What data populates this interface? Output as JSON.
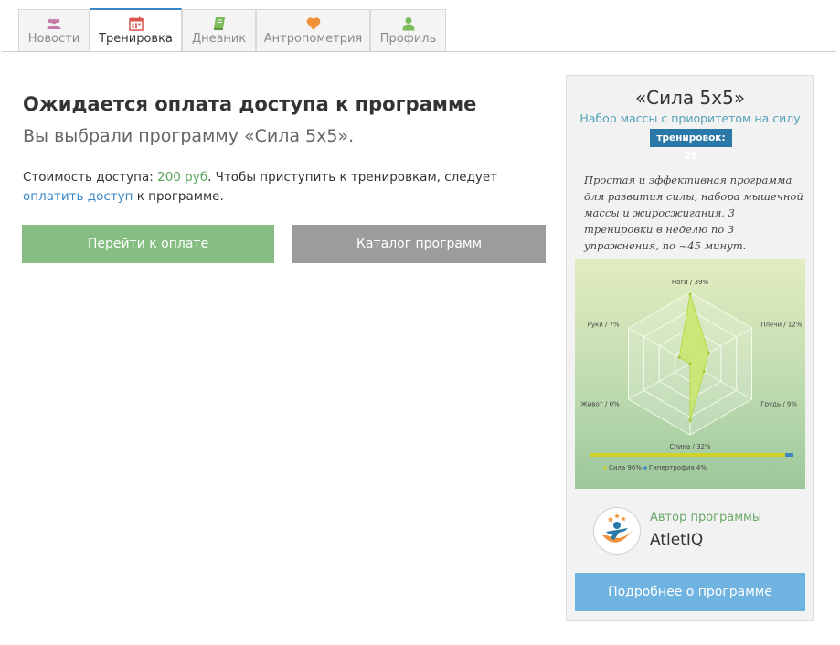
{
  "tabs": [
    {
      "label": "Новости",
      "icon": "users-icon",
      "color": "#c57aa8"
    },
    {
      "label": "Тренировка",
      "icon": "calendar-icon",
      "color": "#d9534f",
      "active": true
    },
    {
      "label": "Дневник",
      "icon": "book-icon",
      "color": "#7dba5a"
    },
    {
      "label": "Антропометрия",
      "icon": "heart-icon",
      "color": "#f0913a"
    },
    {
      "label": "Профиль",
      "icon": "user-icon",
      "color": "#7dba5a"
    }
  ],
  "main": {
    "title": "Ожидается оплата доступа к программе",
    "subtitle": "Вы выбрали программу «Сила 5x5».",
    "price_prefix": "Стоимость доступа: ",
    "price": "200 руб",
    "price_middle": ". Чтобы приступить к тренировкам, следует ",
    "pay_link": "оплатить доступ",
    "price_suffix": " к программе.",
    "pay_button": "Перейти к оплате",
    "catalog_button": "Каталог программ"
  },
  "program": {
    "title": "«Сила 5x5»",
    "subtitle": "Набор массы с приоритетом на силу",
    "badge": "тренировок: 28",
    "description": "Простая и эффективная программа для развития силы, набора мышечной массы и жиросжигания. 3 тренировки в неделю по 3 упражнения, по ~45 минут.",
    "author_label": "Автор программы",
    "author_name": "AtletIQ",
    "more_button": "Подробнее о программе"
  },
  "chart_data": {
    "type": "radar",
    "axes": [
      "Ноги",
      "Плечи",
      "Грудь",
      "Спина",
      "Живот",
      "Руки"
    ],
    "values": [
      39,
      12,
      9,
      32,
      0,
      7
    ],
    "axis_labels": [
      "Ноги / 39%",
      "Плечи / 12%",
      "Грудь / 9%",
      "Спина / 32%",
      "Живот / 0%",
      "Руки / 7%"
    ],
    "rmax": 40,
    "series_color": "#c9e66a",
    "balance": [
      {
        "name": "Сила",
        "value": 96,
        "label": "Сила 96%",
        "color": "#d2d12a"
      },
      {
        "name": "Гипертрофия",
        "value": 4,
        "label": "Гипертрофия 4%",
        "color": "#3f86c5"
      }
    ]
  }
}
